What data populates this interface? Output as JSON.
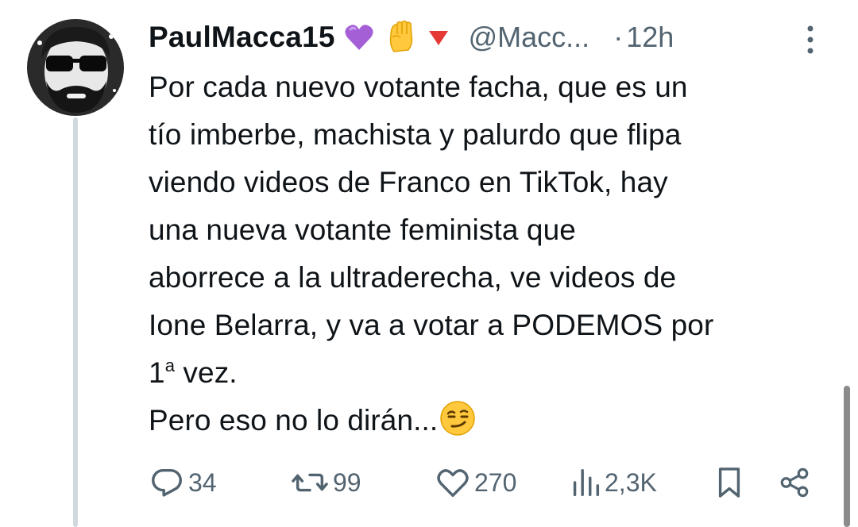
{
  "tweet": {
    "display_name": "PaulMacca15",
    "badges": [
      "purple-heart-icon",
      "raised-fist-icon",
      "red-triangle-icon"
    ],
    "handle": "@Macc...",
    "separator": "·",
    "time": "12h",
    "lines": [
      "Por cada nuevo votante facha, que es un",
      "tío imberbe, machista y palurdo que flipa",
      "viendo videos de Franco en TikTok, hay",
      "una nueva votante feminista que",
      "aborrece a la ultraderecha, ve videos de",
      "Ione Belarra, y va a votar a PODEMOS por"
    ],
    "line_7_number": "1",
    "line_7_superscript": "a",
    "line_7_rest": " vez.",
    "line_8": "Pero eso no lo dirán...",
    "line_8_emoji": "smirking-face-icon"
  },
  "actions": {
    "replies": "34",
    "retweets": "99",
    "likes": "270",
    "views": "2,3K"
  },
  "colors": {
    "text": "#0f1419",
    "secondary": "#536471",
    "thread_line": "#cfd9de"
  }
}
